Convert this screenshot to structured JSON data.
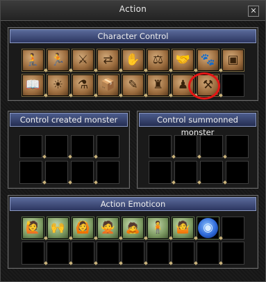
{
  "window": {
    "title": "Action",
    "close_label": "✕"
  },
  "character_control": {
    "header": "Character Control",
    "row1": [
      {
        "name": "sit-stand-icon",
        "glyph": "🧎"
      },
      {
        "name": "walk-run-icon",
        "glyph": "🏃"
      },
      {
        "name": "attack-icon",
        "glyph": "⚔"
      },
      {
        "name": "exchange-icon",
        "glyph": "⇄"
      },
      {
        "name": "pickup-icon",
        "glyph": "✋"
      },
      {
        "name": "private-store-icon",
        "glyph": "⚖"
      },
      {
        "name": "handshake-icon",
        "glyph": "🤝"
      },
      {
        "name": "pet-icon",
        "glyph": "🐾"
      },
      {
        "name": "treasure-chest-icon",
        "glyph": "▣"
      }
    ],
    "row2": [
      {
        "name": "recipe-book-icon",
        "glyph": "📖"
      },
      {
        "name": "sun-icon",
        "glyph": "☀"
      },
      {
        "name": "craft-icon",
        "glyph": "⚗"
      },
      {
        "name": "package-icon",
        "glyph": "📦"
      },
      {
        "name": "quill-icon",
        "glyph": "✎"
      },
      {
        "name": "statue-icon",
        "glyph": "♜"
      },
      {
        "name": "figure-icon",
        "glyph": "♟"
      },
      {
        "name": "sword-in-stone-icon",
        "glyph": "⚒"
      }
    ]
  },
  "created_monster": {
    "header": "Control created monster"
  },
  "summoned_monster": {
    "header": "Control summonned monster"
  },
  "action_emoticon": {
    "header": "Action Emoticon",
    "row1": [
      {
        "name": "greeting-emote-icon",
        "glyph": "🙋"
      },
      {
        "name": "victory-emote-icon",
        "glyph": "🙌"
      },
      {
        "name": "advance-emote-icon",
        "glyph": "🙆"
      },
      {
        "name": "no-emote-icon",
        "glyph": "🙅"
      },
      {
        "name": "yes-emote-icon",
        "glyph": "🙇"
      },
      {
        "name": "bow-emote-icon",
        "glyph": "🧍"
      },
      {
        "name": "unaware-emote-icon",
        "glyph": "🤷"
      },
      {
        "name": "social-orb-icon",
        "glyph": "◉"
      }
    ]
  },
  "colors": {
    "highlight": "#e41515",
    "header_blue": "#3b4775",
    "slot_border": "#7b6a40"
  }
}
